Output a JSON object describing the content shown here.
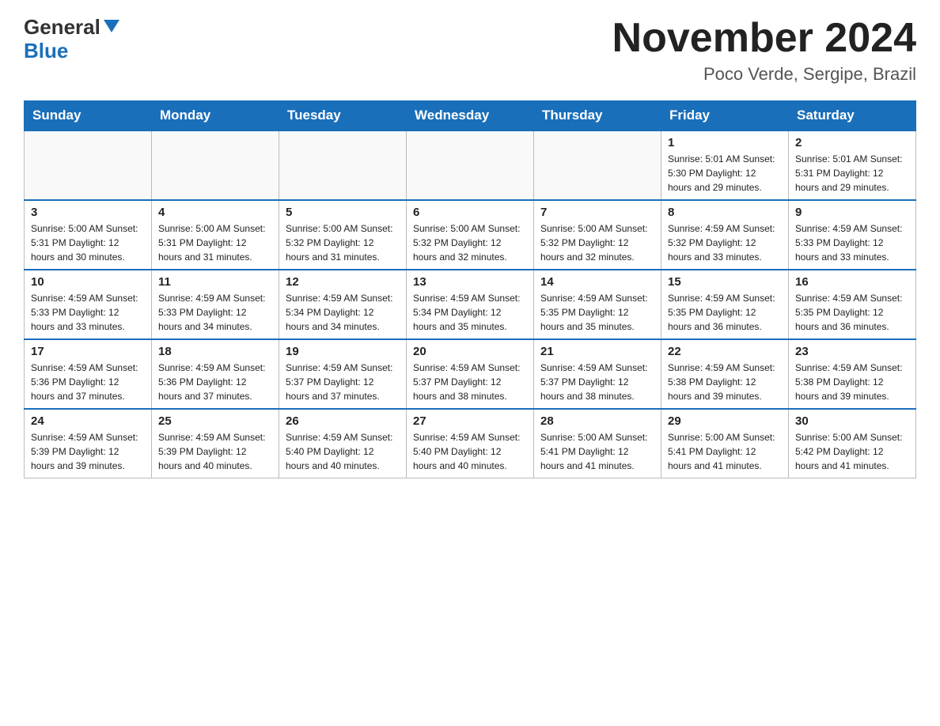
{
  "header": {
    "logo_general": "General",
    "logo_blue": "Blue",
    "month_title": "November 2024",
    "subtitle": "Poco Verde, Sergipe, Brazil"
  },
  "days_of_week": [
    "Sunday",
    "Monday",
    "Tuesday",
    "Wednesday",
    "Thursday",
    "Friday",
    "Saturday"
  ],
  "weeks": [
    [
      {
        "day": "",
        "info": ""
      },
      {
        "day": "",
        "info": ""
      },
      {
        "day": "",
        "info": ""
      },
      {
        "day": "",
        "info": ""
      },
      {
        "day": "",
        "info": ""
      },
      {
        "day": "1",
        "info": "Sunrise: 5:01 AM\nSunset: 5:30 PM\nDaylight: 12 hours\nand 29 minutes."
      },
      {
        "day": "2",
        "info": "Sunrise: 5:01 AM\nSunset: 5:31 PM\nDaylight: 12 hours\nand 29 minutes."
      }
    ],
    [
      {
        "day": "3",
        "info": "Sunrise: 5:00 AM\nSunset: 5:31 PM\nDaylight: 12 hours\nand 30 minutes."
      },
      {
        "day": "4",
        "info": "Sunrise: 5:00 AM\nSunset: 5:31 PM\nDaylight: 12 hours\nand 31 minutes."
      },
      {
        "day": "5",
        "info": "Sunrise: 5:00 AM\nSunset: 5:32 PM\nDaylight: 12 hours\nand 31 minutes."
      },
      {
        "day": "6",
        "info": "Sunrise: 5:00 AM\nSunset: 5:32 PM\nDaylight: 12 hours\nand 32 minutes."
      },
      {
        "day": "7",
        "info": "Sunrise: 5:00 AM\nSunset: 5:32 PM\nDaylight: 12 hours\nand 32 minutes."
      },
      {
        "day": "8",
        "info": "Sunrise: 4:59 AM\nSunset: 5:32 PM\nDaylight: 12 hours\nand 33 minutes."
      },
      {
        "day": "9",
        "info": "Sunrise: 4:59 AM\nSunset: 5:33 PM\nDaylight: 12 hours\nand 33 minutes."
      }
    ],
    [
      {
        "day": "10",
        "info": "Sunrise: 4:59 AM\nSunset: 5:33 PM\nDaylight: 12 hours\nand 33 minutes."
      },
      {
        "day": "11",
        "info": "Sunrise: 4:59 AM\nSunset: 5:33 PM\nDaylight: 12 hours\nand 34 minutes."
      },
      {
        "day": "12",
        "info": "Sunrise: 4:59 AM\nSunset: 5:34 PM\nDaylight: 12 hours\nand 34 minutes."
      },
      {
        "day": "13",
        "info": "Sunrise: 4:59 AM\nSunset: 5:34 PM\nDaylight: 12 hours\nand 35 minutes."
      },
      {
        "day": "14",
        "info": "Sunrise: 4:59 AM\nSunset: 5:35 PM\nDaylight: 12 hours\nand 35 minutes."
      },
      {
        "day": "15",
        "info": "Sunrise: 4:59 AM\nSunset: 5:35 PM\nDaylight: 12 hours\nand 36 minutes."
      },
      {
        "day": "16",
        "info": "Sunrise: 4:59 AM\nSunset: 5:35 PM\nDaylight: 12 hours\nand 36 minutes."
      }
    ],
    [
      {
        "day": "17",
        "info": "Sunrise: 4:59 AM\nSunset: 5:36 PM\nDaylight: 12 hours\nand 37 minutes."
      },
      {
        "day": "18",
        "info": "Sunrise: 4:59 AM\nSunset: 5:36 PM\nDaylight: 12 hours\nand 37 minutes."
      },
      {
        "day": "19",
        "info": "Sunrise: 4:59 AM\nSunset: 5:37 PM\nDaylight: 12 hours\nand 37 minutes."
      },
      {
        "day": "20",
        "info": "Sunrise: 4:59 AM\nSunset: 5:37 PM\nDaylight: 12 hours\nand 38 minutes."
      },
      {
        "day": "21",
        "info": "Sunrise: 4:59 AM\nSunset: 5:37 PM\nDaylight: 12 hours\nand 38 minutes."
      },
      {
        "day": "22",
        "info": "Sunrise: 4:59 AM\nSunset: 5:38 PM\nDaylight: 12 hours\nand 39 minutes."
      },
      {
        "day": "23",
        "info": "Sunrise: 4:59 AM\nSunset: 5:38 PM\nDaylight: 12 hours\nand 39 minutes."
      }
    ],
    [
      {
        "day": "24",
        "info": "Sunrise: 4:59 AM\nSunset: 5:39 PM\nDaylight: 12 hours\nand 39 minutes."
      },
      {
        "day": "25",
        "info": "Sunrise: 4:59 AM\nSunset: 5:39 PM\nDaylight: 12 hours\nand 40 minutes."
      },
      {
        "day": "26",
        "info": "Sunrise: 4:59 AM\nSunset: 5:40 PM\nDaylight: 12 hours\nand 40 minutes."
      },
      {
        "day": "27",
        "info": "Sunrise: 4:59 AM\nSunset: 5:40 PM\nDaylight: 12 hours\nand 40 minutes."
      },
      {
        "day": "28",
        "info": "Sunrise: 5:00 AM\nSunset: 5:41 PM\nDaylight: 12 hours\nand 41 minutes."
      },
      {
        "day": "29",
        "info": "Sunrise: 5:00 AM\nSunset: 5:41 PM\nDaylight: 12 hours\nand 41 minutes."
      },
      {
        "day": "30",
        "info": "Sunrise: 5:00 AM\nSunset: 5:42 PM\nDaylight: 12 hours\nand 41 minutes."
      }
    ]
  ]
}
